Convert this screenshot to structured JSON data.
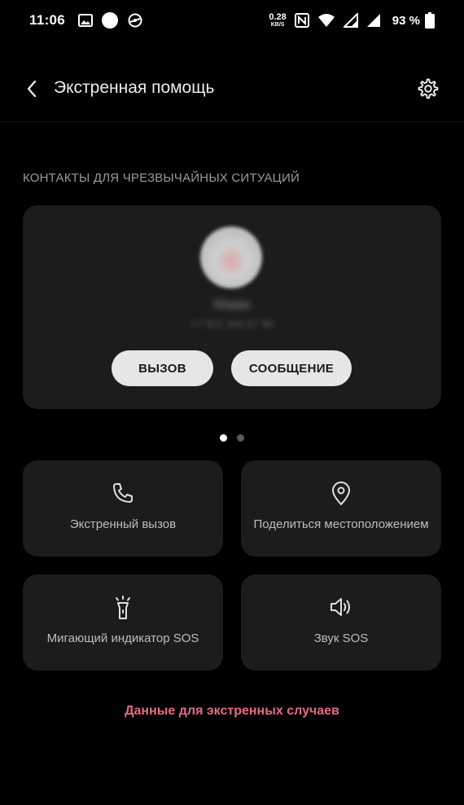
{
  "status_bar": {
    "time": "11:06",
    "speed_value": "0.28",
    "speed_unit": "KB/S",
    "battery": "93 %"
  },
  "header": {
    "title": "Экстренная помощь"
  },
  "section": {
    "heading": "КОНТАКТЫ ДЛЯ ЧРЕЗВЫЧАЙНЫХ СИТУАЦИЙ"
  },
  "contact_card": {
    "name": "Мама",
    "phone": "+7 912 345 67 89",
    "call_label": "ВЫЗОВ",
    "message_label": "СООБЩЕНИЕ"
  },
  "pager": {
    "count": 2,
    "active": 0
  },
  "tiles": [
    {
      "label": "Экстренный вызов",
      "icon": "phone-icon"
    },
    {
      "label": "Поделиться местоположением",
      "icon": "location-pin-icon"
    },
    {
      "label": "Мигающий индикатор SOS",
      "icon": "flashlight-icon"
    },
    {
      "label": "Звук SOS",
      "icon": "speaker-icon"
    }
  ],
  "footer": {
    "link": "Данные для экстренных случаев"
  },
  "colors": {
    "background": "#000000",
    "card": "#1c1c1e",
    "accent_link": "#e56b83",
    "button_bg": "#e6e6e6"
  }
}
